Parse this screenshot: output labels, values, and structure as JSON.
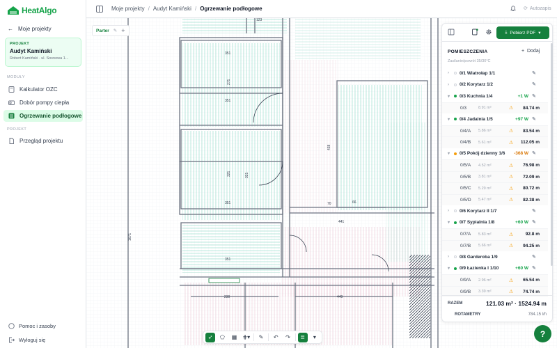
{
  "app": {
    "name": "HeatAlgo"
  },
  "sidebar": {
    "back_label": "Moje projekty",
    "project_label": "PROJEKT",
    "project_title": "Audyt Kamiński",
    "project_sub": "Robert Kamiński · ul. Sosnowa 1...",
    "modules_header": "MODUŁY",
    "items": [
      {
        "label": "Kalkulator OZC",
        "icon": "calculator-icon"
      },
      {
        "label": "Dobór pompy ciepła",
        "icon": "pump-icon"
      },
      {
        "label": "Ogrzewanie podłogowe",
        "icon": "floor-heating-icon",
        "active": true
      }
    ],
    "project_header": "PROJEKT",
    "project_items": [
      {
        "label": "Przegląd projektu",
        "icon": "document-icon"
      }
    ],
    "footer": [
      {
        "label": "Pomoc i zasoby",
        "icon": "help-icon"
      },
      {
        "label": "Wyloguj się",
        "icon": "logout-icon"
      }
    ]
  },
  "header": {
    "breadcrumbs": [
      "Moje projekty",
      "Audyt Kamiński",
      "Ogrzewanie podłogowe"
    ],
    "logout": "Autozapis"
  },
  "canvas": {
    "floor_tab": "Parter",
    "dims": [
      "123",
      "351",
      "271",
      "351",
      "321",
      "321",
      "351",
      "438",
      "66",
      "70",
      "441",
      "351",
      "230",
      "449",
      "1671"
    ]
  },
  "panel": {
    "pdf_label": "Pobierz PDF",
    "title": "POMIESZCZENIA",
    "add_label": "Dodaj",
    "subtitle": "Zasilanie/powrót 35/30°C",
    "rooms": [
      {
        "name": "0/1 Wiatrołap 1/1",
        "status": "none",
        "delta": "",
        "subs": []
      },
      {
        "name": "0/2 Korytarz 1/2",
        "status": "none",
        "delta": "",
        "subs": []
      },
      {
        "name": "0/3 Kuchnia 1/4",
        "status": "green",
        "delta": "+1 W",
        "subs": [
          {
            "name": "0/3",
            "area": "8.91 m²",
            "len": "84.74 m"
          }
        ]
      },
      {
        "name": "0/4 Jadalnia 1/5",
        "status": "green",
        "delta": "+97 W",
        "subs": [
          {
            "name": "0/4/A",
            "area": "5.86 m²",
            "len": "83.54 m"
          },
          {
            "name": "0/4/B",
            "area": "5.61 m²",
            "len": "112.05 m"
          }
        ]
      },
      {
        "name": "0/5 Pokój dzienny 1/6",
        "status": "orange",
        "delta": "-368 W",
        "subs": [
          {
            "name": "0/5/A",
            "area": "4.52 m²",
            "len": "76.98 m"
          },
          {
            "name": "0/5/B",
            "area": "3.81 m²",
            "len": "72.09 m"
          },
          {
            "name": "0/5/C",
            "area": "5.29 m²",
            "len": "80.72 m"
          },
          {
            "name": "0/5/D",
            "area": "5.47 m²",
            "len": "82.38 m"
          }
        ]
      },
      {
        "name": "0/6 Korytarz II 1/7",
        "status": "none",
        "delta": "",
        "subs": []
      },
      {
        "name": "0/7 Sypialnia 1/8",
        "status": "green",
        "delta": "+60 W",
        "subs": [
          {
            "name": "0/7/A",
            "area": "5.83 m²",
            "len": "92.8 m"
          },
          {
            "name": "0/7/B",
            "area": "5.66 m²",
            "len": "94.25 m"
          }
        ]
      },
      {
        "name": "0/8 Garderoba 1/9",
        "status": "none",
        "delta": "",
        "subs": []
      },
      {
        "name": "0/9 Łazienka I 1/10",
        "status": "green",
        "delta": "+60 W",
        "subs": [
          {
            "name": "0/9/A",
            "area": "2.96 m²",
            "len": "65.54 m"
          },
          {
            "name": "0/9/B",
            "area": "3.39 m²",
            "len": "74.74 m"
          }
        ]
      }
    ],
    "total_label": "RAZEM",
    "total_value": "121.03 m² · 1524.94 m",
    "rot_label": "ROTAMETRY",
    "rot_value": "784.15 l/h"
  },
  "toolbar": {
    "tools": [
      "select-icon",
      "polygon-icon",
      "grid-icon",
      "manifold-icon",
      "pencil-icon",
      "undo-icon",
      "redo-icon",
      "layers-icon"
    ]
  },
  "help": "?",
  "colors": {
    "accent": "#15803d",
    "accent_light": "#dcfce7",
    "loop": "#7dd3c0",
    "wall": "#6b7280"
  }
}
